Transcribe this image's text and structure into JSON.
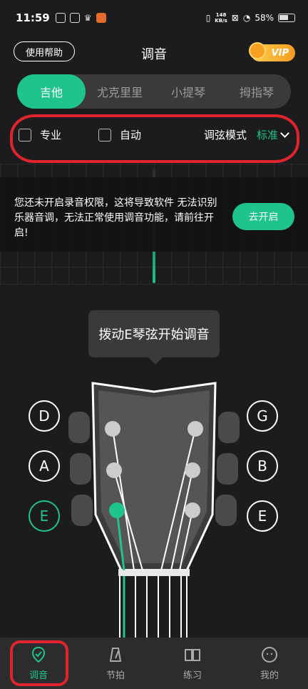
{
  "status_bar": {
    "time": "11:59",
    "speed_top": "148",
    "speed_bottom": "KB/s",
    "battery": "58%"
  },
  "header": {
    "help_label": "使用帮助",
    "title": "调音",
    "vip_label": "VIP"
  },
  "tabs": [
    {
      "label": "吉他",
      "active": true
    },
    {
      "label": "尤克里里",
      "active": false
    },
    {
      "label": "小提琴",
      "active": false
    },
    {
      "label": "拇指琴",
      "active": false
    }
  ],
  "options": {
    "pro_label": "专业",
    "auto_label": "自动",
    "mode_label": "调弦模式",
    "mode_value": "标准"
  },
  "notice": {
    "text": "您还未开启录音权限，这将导致软件 无法识别乐器音调，无法正常使用调音功能，请前往开启!",
    "button": "去开启"
  },
  "tooltip": "拨动E琴弦开始调音",
  "strings_left": [
    "D",
    "A",
    "E"
  ],
  "strings_right": [
    "G",
    "B",
    "E"
  ],
  "active_string": "E-low",
  "nav": [
    {
      "label": "调音",
      "icon": "tuner-icon",
      "active": true
    },
    {
      "label": "节拍",
      "icon": "metronome-icon",
      "active": false
    },
    {
      "label": "练习",
      "icon": "book-icon",
      "active": false
    },
    {
      "label": "我的",
      "icon": "profile-icon",
      "active": false
    }
  ],
  "colors": {
    "accent": "#1fc38c",
    "highlight": "#e0242d",
    "background": "#1c1c1e"
  }
}
